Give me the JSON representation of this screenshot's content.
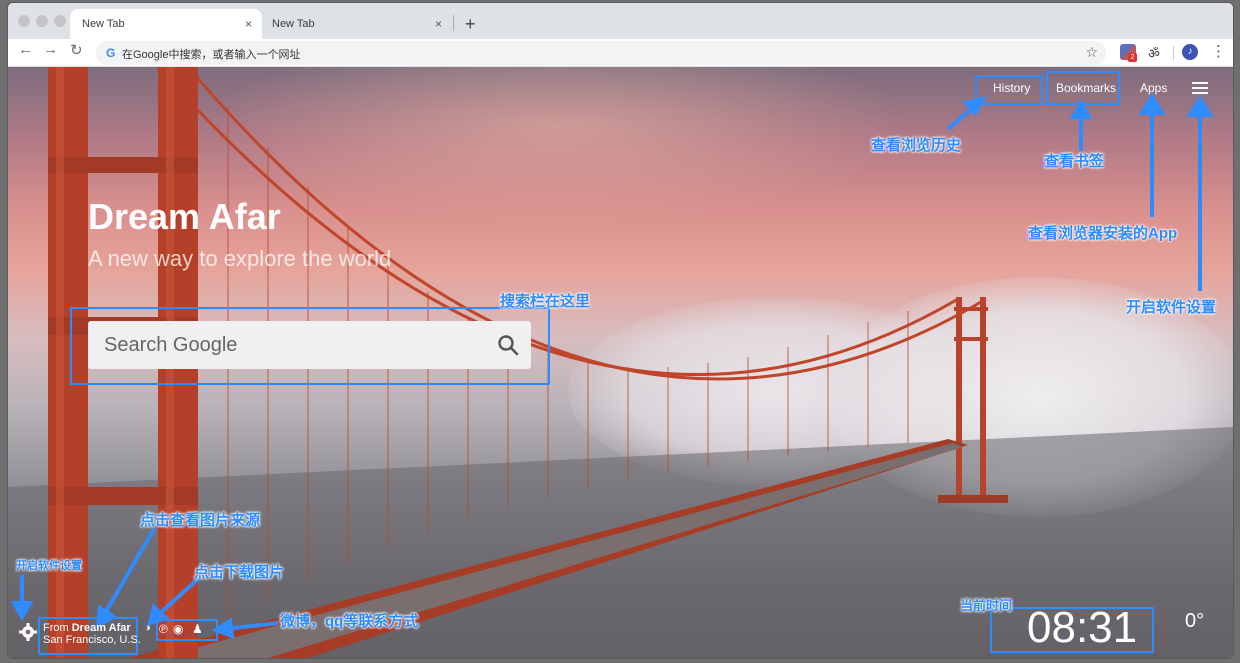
{
  "browser": {
    "tabs": [
      {
        "label": "New Tab",
        "close": "×"
      },
      {
        "label": "New Tab",
        "close": "×"
      }
    ],
    "new_tab": "+",
    "back": "←",
    "forward": "→",
    "reload": "↻",
    "omnibox_logo": "G",
    "omnibox_placeholder": "在Google中搜索，或者输入一个网址",
    "star": "☆",
    "extension_badge": "2",
    "extension_2": "ॐ",
    "extension_3": "♪",
    "menu": "⋮"
  },
  "top_nav": {
    "history": "History",
    "bookmarks": "Bookmarks",
    "apps": "Apps"
  },
  "brand": {
    "title": "Dream Afar",
    "subtitle": "A new way to explore the world"
  },
  "search": {
    "placeholder": "Search Google"
  },
  "footer": {
    "from_prefix": "From",
    "from_source": "Dream Afar",
    "location": "San Francisco, U.S.",
    "time": "08:31",
    "temperature": "0°"
  },
  "annotations": {
    "history": "查看浏览历史",
    "bookmarks": "查看书签",
    "apps": "查看浏览器安装的App",
    "menu_settings": "开启软件设置",
    "search": "搜索栏在这里",
    "image_source": "点击查看图片来源",
    "download": "点击下载图片",
    "social": "微博，qq等联系方式",
    "settings_left": "开启软件设置",
    "time": "当前时间"
  },
  "colors": {
    "annotation": "#2f8cff",
    "bridge": "#c0452a"
  }
}
